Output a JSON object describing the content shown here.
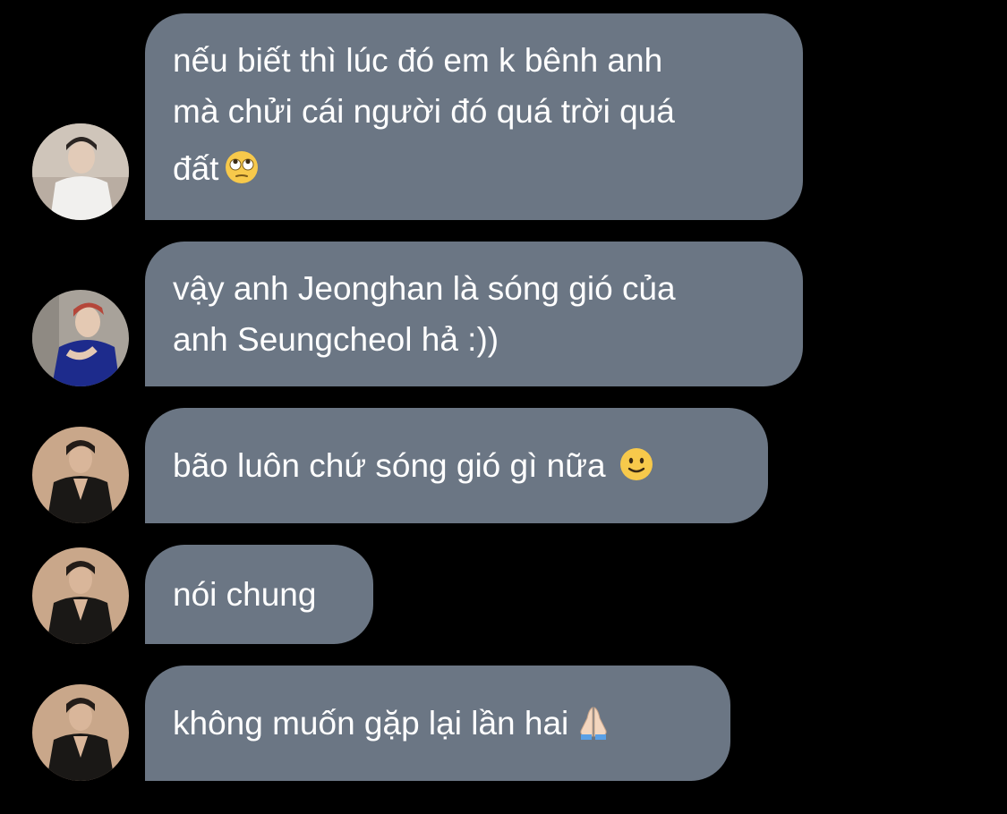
{
  "messages": [
    {
      "lines": [
        "nếu biết thì lúc đó em k bênh anh",
        "mà chửi cái người đó quá trời quá",
        "đất"
      ],
      "emoji": "eye-roll-emoji"
    },
    {
      "lines": [
        "vậy anh Jeonghan là sóng gió của",
        "anh Seungcheol hả :))"
      ],
      "emoji": ""
    },
    {
      "lines": [
        "bão luôn chứ sóng gió gì nữa"
      ],
      "emoji": "slight-smile-emoji"
    },
    {
      "lines": [
        "nói chung"
      ],
      "emoji": ""
    },
    {
      "lines": [
        "không muốn gặp lại lần hai"
      ],
      "emoji": "folded-hands-emoji"
    }
  ],
  "colors": {
    "background": "#000000",
    "bubble": "#6b7684",
    "text": "#ffffff"
  }
}
